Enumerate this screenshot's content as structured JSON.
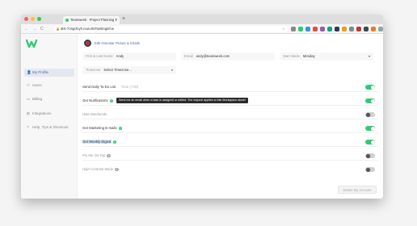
{
  "browser": {
    "tab_title": "Teamweek - Project Planning T",
    "tab_close": "×",
    "new_tab": "+",
    "url": "dist-7c8gcfeyh.now.sh/#settings/me",
    "nav_back": "←",
    "nav_forward": "→",
    "nav_reload": "C"
  },
  "sidebar": {
    "items": [
      {
        "label": "My Profile",
        "icon": "user-icon"
      },
      {
        "label": "Users",
        "icon": "users-icon"
      },
      {
        "label": "Billing",
        "icon": "billing-icon"
      },
      {
        "label": "Integrations",
        "icon": "integrations-icon"
      },
      {
        "label": "Help, Tips & Shortcuts",
        "icon": "help-icon"
      }
    ]
  },
  "profile": {
    "edit_picture_label": "Edit Gravatar Picture & Initials",
    "name_label": "First & Last Name:",
    "name_value": "Andy",
    "email_label": "Email:",
    "email_value": "andy@teamweek.com",
    "start_week_label": "Start Week:",
    "start_week_value": "Monday",
    "timezone_label": "Timezone:",
    "timezone_value": "Select Timezone..."
  },
  "settings": [
    {
      "label": "Send Daily To-Do List",
      "time_label": "Time (7:00)",
      "state": "on",
      "muted": false
    },
    {
      "label": "Get Notifications",
      "state": "on",
      "muted": false,
      "info": true
    },
    {
      "label": "Hide Weekends",
      "state": "off",
      "muted": true
    },
    {
      "label": "Get Marketing E-mails",
      "state": "on",
      "muted": false,
      "info": true
    },
    {
      "label": "Get Weekly Digest",
      "state": "on",
      "muted": false,
      "info": true,
      "highlight": true
    },
    {
      "label": "Pin Me On Top",
      "state": "off",
      "muted": true,
      "info": true
    },
    {
      "label": "High Contrast Mode",
      "state": "off",
      "muted": true,
      "info": true
    }
  ],
  "tooltip": "Send me an email when a task is assigned or edited. The request applies to this Workspace alone!",
  "delete_label": "Delete My Account",
  "info_glyph": "?",
  "colors": {
    "accent": "#2ecc71",
    "link": "#4a6fa5",
    "tooltip_bg": "#2b2b2b"
  }
}
